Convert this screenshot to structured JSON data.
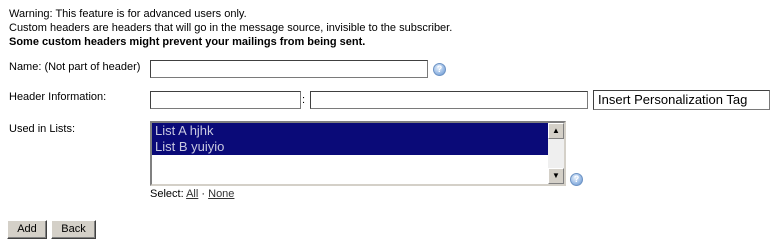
{
  "warning": {
    "line1": "Warning: This feature is for advanced users only.",
    "line2": "Custom headers are headers that will go in the message source, invisible to the subscriber.",
    "line3": "Some custom headers might prevent your mailings from being sent."
  },
  "form": {
    "name_label": "Name: (Not part of header)",
    "name_value": "",
    "header_label": "Header Information:",
    "header_name_value": "",
    "header_separator": ":",
    "header_value": "",
    "personalization_select": "Insert Personalization Tag",
    "lists_label": "Used in Lists:",
    "lists": [
      {
        "label": "List A hjhk",
        "selected": true
      },
      {
        "label": "List B yuiyio",
        "selected": true
      }
    ],
    "select_prefix": "Select:",
    "select_all": "All",
    "select_sep": "·",
    "select_none": "None"
  },
  "icons": {
    "help": "question-help-icon",
    "scroll_up": "scroll-up-arrow-icon",
    "scroll_down": "scroll-down-arrow-icon"
  },
  "buttons": {
    "add": "Add",
    "back": "Back"
  }
}
